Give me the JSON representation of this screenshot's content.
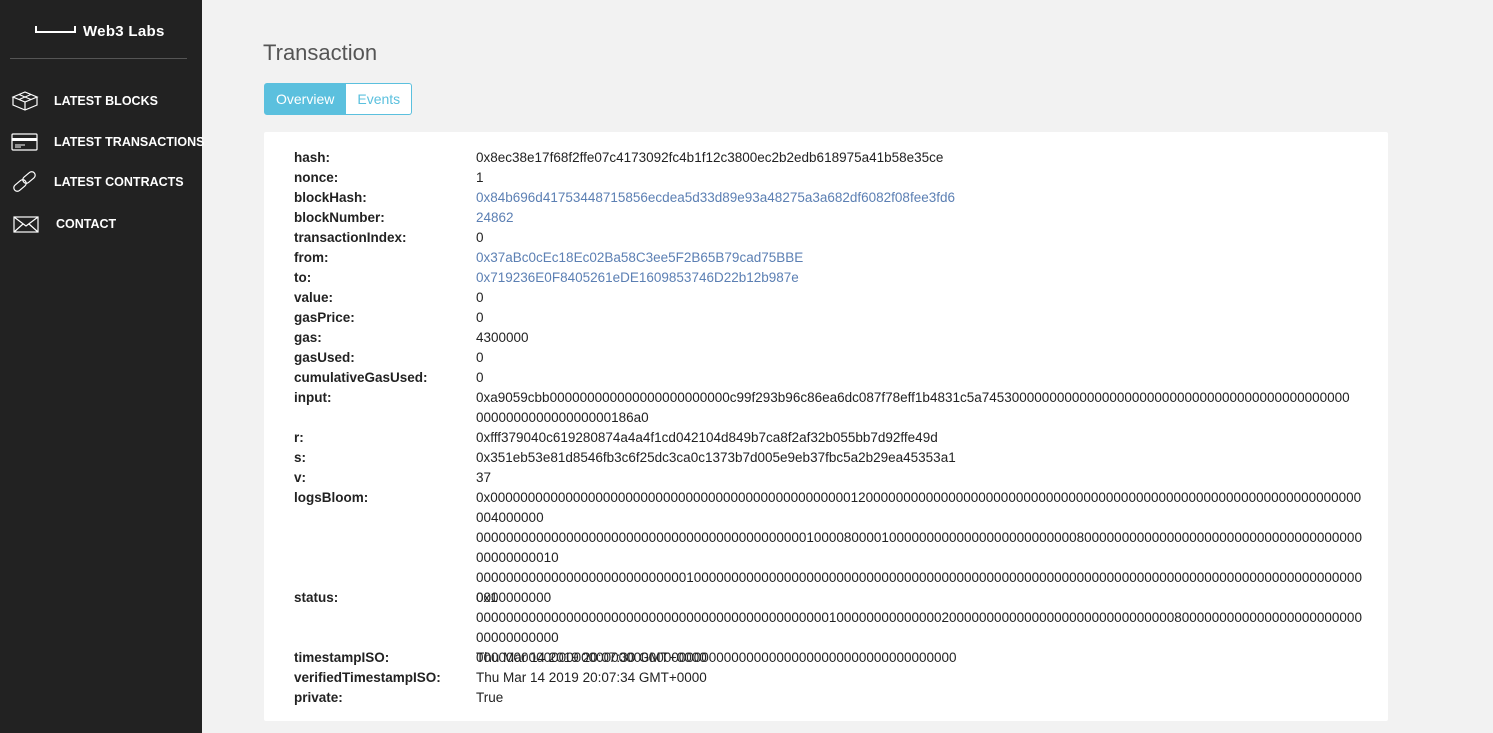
{
  "brand": {
    "name": "Web3  Labs"
  },
  "nav": [
    {
      "label": "LATEST BLOCKS",
      "icon": "blocks-icon"
    },
    {
      "label": "LATEST TRANSACTIONS",
      "icon": "card-icon"
    },
    {
      "label": "LATEST CONTRACTS",
      "icon": "link-icon"
    },
    {
      "label": "CONTACT",
      "icon": "envelope-icon"
    }
  ],
  "page": {
    "title": "Transaction"
  },
  "tabs": {
    "overview": "Overview",
    "events": "Events"
  },
  "colors": {
    "sidebar": "#222222",
    "accent": "#5bc0de",
    "link": "#5b7fb3",
    "background": "#f2f2f2"
  },
  "tx": {
    "hash": {
      "key": "hash:",
      "value": "0x8ec38e17f68f2ffe07c4173092fc4b1f12c3800ec2b2edb618975a41b58e35ce"
    },
    "nonce": {
      "key": "nonce:",
      "value": "1"
    },
    "blockHash": {
      "key": "blockHash:",
      "value": "0x84b696d41753448715856ecdea5d33d89e93a48275a3a682df6082f08fee3fd6"
    },
    "blockNumber": {
      "key": "blockNumber:",
      "value": "24862"
    },
    "transactionIndex": {
      "key": "transactionIndex:",
      "value": "0"
    },
    "from": {
      "key": "from:",
      "value": "0x37aBc0cEc18Ec02Ba58C3ee5F2B65B79cad75BBE"
    },
    "to": {
      "key": "to:",
      "value": "0x719236E0F8405261eDE1609853746D22b12b987e"
    },
    "value": {
      "key": "value:",
      "value": "0"
    },
    "gasPrice": {
      "key": "gasPrice:",
      "value": "0"
    },
    "gas": {
      "key": "gas:",
      "value": "4300000"
    },
    "gasUsed": {
      "key": "gasUsed:",
      "value": "0"
    },
    "cumulativeGasUsed": {
      "key": "cumulativeGasUsed:",
      "value": "0"
    },
    "input": {
      "key": "input:",
      "line1": "0xa9059cbb000000000000000000000000c99f293b96c86ea6dc087f78eff1b4831c5a7453000000000000000000000000000000000000000000000",
      "line2": "000000000000000000186a0"
    },
    "r": {
      "key": "r:",
      "value": "0xfff379040c619280874a4a4f1cd042104d849b7ca8f2af32b055bb7d92ffe49d"
    },
    "s": {
      "key": "s:",
      "value": "0x351eb53e81d8546fb3c6f25dc3ca0c1373b7d005e9eb37fbc5a2b29ea45353a1"
    },
    "v": {
      "key": "v:",
      "value": "37"
    },
    "logsBloom": {
      "key": "logsBloom:",
      "line1": "0x00000000000000000000000000000000000000000000000012000000000000000000000000000000000000000000000000000000000000000000004000000",
      "line2": "000000000000000000000000000000000000000000001000080000100000000000000000000000008000000000000000000000000000000000000000000000010",
      "line3": "00000000000000000000000000001000000000000000000000000000000000000000000000000000000000000000000000000000000000000000000000000000",
      "line4": "000000000000000000000000000000000000000000000001000000000000002000000000000000000000000000000800000000000000000000000000000000000",
      "line5": "0000000000000000000000000000000000000000000000000000000000000000"
    },
    "status": {
      "key": "status:",
      "value": "0x1"
    },
    "timestampISO": {
      "key": "timestampISO:",
      "value": "Thu Mar 14 2019 20:07:30 GMT+0000"
    },
    "verifiedTimestampISO": {
      "key": "verifiedTimestampISO:",
      "value": "Thu Mar 14 2019 20:07:34 GMT+0000"
    },
    "private": {
      "key": "private:",
      "value": "True"
    }
  }
}
